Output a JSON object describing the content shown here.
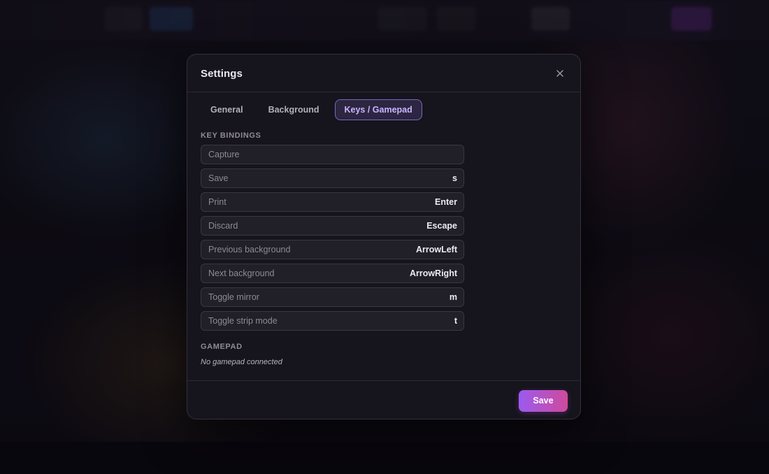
{
  "modal": {
    "title": "Settings",
    "close_icon": "close-icon"
  },
  "tabs": [
    {
      "label": "General",
      "active": false
    },
    {
      "label": "Background",
      "active": false
    },
    {
      "label": "Keys / Gamepad",
      "active": true
    }
  ],
  "key_bindings": {
    "heading": "KEY BINDINGS",
    "items": [
      {
        "action": "Capture",
        "key": ""
      },
      {
        "action": "Save",
        "key": "s"
      },
      {
        "action": "Print",
        "key": "Enter"
      },
      {
        "action": "Discard",
        "key": "Escape"
      },
      {
        "action": "Previous background",
        "key": "ArrowLeft"
      },
      {
        "action": "Next background",
        "key": "ArrowRight"
      },
      {
        "action": "Toggle mirror",
        "key": "m"
      },
      {
        "action": "Toggle strip mode",
        "key": "t"
      }
    ]
  },
  "gamepad": {
    "heading": "GAMEPAD",
    "status": "No gamepad connected"
  },
  "footer": {
    "save_label": "Save"
  },
  "colors": {
    "accent_purple": "#9a5bf0",
    "accent_pink": "#d04a9c",
    "active_tab_text": "#c9b3ff"
  }
}
